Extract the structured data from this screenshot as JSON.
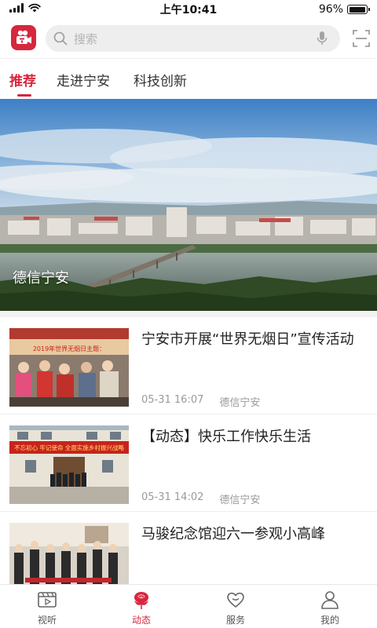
{
  "status_bar": {
    "time": "上午10:41",
    "battery": "96%",
    "battery_level": 0.96
  },
  "header": {
    "search_placeholder": "搜索"
  },
  "tabs": [
    {
      "label": "推荐",
      "active": true
    },
    {
      "label": "走进宁安",
      "active": false
    },
    {
      "label": "科技创新",
      "active": false
    }
  ],
  "banner": {
    "caption": "德信宁安"
  },
  "news": [
    {
      "title": "宁安市开展“世界无烟日”宣传活动",
      "date": "05-31 16:07",
      "source": "德信宁安",
      "thumb_banner": "2019年世界无烟日主题："
    },
    {
      "title": "【动态】快乐工作快乐生活",
      "date": "05-31 14:02",
      "source": "德信宁安",
      "thumb_banner": "不忘初心 牢记使命 全面实施乡村振兴战略"
    },
    {
      "title": "马骏纪念馆迎六一参观小高峰",
      "date": "",
      "source": "",
      "thumb_banner": ""
    }
  ],
  "bottom_nav": [
    {
      "label": "视听",
      "icon": "film-icon",
      "active": false
    },
    {
      "label": "动态",
      "icon": "rose-icon",
      "active": true
    },
    {
      "label": "服务",
      "icon": "heart-icon",
      "active": false
    },
    {
      "label": "我的",
      "icon": "person-icon",
      "active": false
    }
  ],
  "colors": {
    "accent": "#d7263d",
    "muted": "#9a9a9a",
    "band": "#f2f2f2"
  }
}
